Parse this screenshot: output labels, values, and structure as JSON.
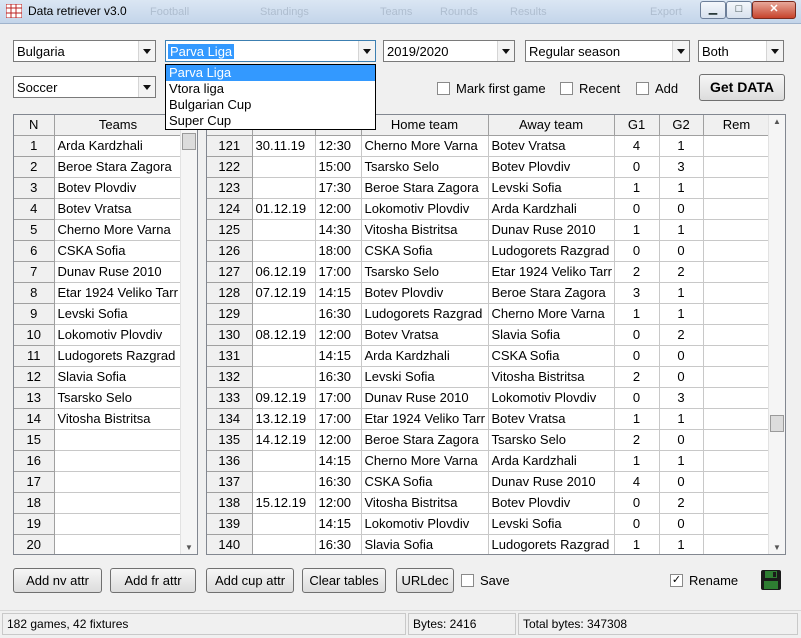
{
  "window": {
    "title": "Data retriever v3.0",
    "background_tabs": [
      "Football",
      "Standings",
      "Teams",
      "Rounds",
      "Results",
      "Export"
    ]
  },
  "filters": {
    "country": "Bulgaria",
    "league": "Parva Liga",
    "league_options": [
      "Parva Liga",
      "Vtora liga",
      "Bulgarian Cup",
      "Super Cup"
    ],
    "season": "2019/2020",
    "stage": "Regular season",
    "side": "Both",
    "sport": "Soccer"
  },
  "options": {
    "mark_first_game": "Mark first game",
    "recent": "Recent",
    "add": "Add",
    "get_data": "Get DATA"
  },
  "teams_grid": {
    "headers": [
      "N",
      "Teams"
    ],
    "rows": [
      [
        "1",
        "Arda Kardzhali"
      ],
      [
        "2",
        "Beroe Stara Zagora"
      ],
      [
        "3",
        "Botev Plovdiv"
      ],
      [
        "4",
        "Botev Vratsa"
      ],
      [
        "5",
        "Cherno More Varna"
      ],
      [
        "6",
        "CSKA Sofia"
      ],
      [
        "7",
        "Dunav Ruse 2010"
      ],
      [
        "8",
        "Etar 1924 Veliko Tarr"
      ],
      [
        "9",
        "Levski Sofia"
      ],
      [
        "10",
        "Lokomotiv Plovdiv"
      ],
      [
        "11",
        "Ludogorets Razgrad"
      ],
      [
        "12",
        "Slavia Sofia"
      ],
      [
        "13",
        "Tsarsko Selo"
      ],
      [
        "14",
        "Vitosha Bistritsa"
      ],
      [
        "15",
        ""
      ],
      [
        "16",
        ""
      ],
      [
        "17",
        ""
      ],
      [
        "18",
        ""
      ],
      [
        "19",
        ""
      ],
      [
        "20",
        ""
      ]
    ]
  },
  "games_grid": {
    "headers": [
      "",
      "",
      "",
      "Home team",
      "Away team",
      "G1",
      "G2",
      "Rem"
    ],
    "rows": [
      [
        "121",
        "30.11.19",
        "12:30",
        "Cherno More Varna",
        "Botev Vratsa",
        "4",
        "1",
        ""
      ],
      [
        "122",
        "",
        "15:00",
        "Tsarsko Selo",
        "Botev Plovdiv",
        "0",
        "3",
        ""
      ],
      [
        "123",
        "",
        "17:30",
        "Beroe Stara Zagora",
        "Levski Sofia",
        "1",
        "1",
        ""
      ],
      [
        "124",
        "01.12.19",
        "12:00",
        "Lokomotiv Plovdiv",
        "Arda Kardzhali",
        "0",
        "0",
        ""
      ],
      [
        "125",
        "",
        "14:30",
        "Vitosha Bistritsa",
        "Dunav Ruse 2010",
        "1",
        "1",
        ""
      ],
      [
        "126",
        "",
        "18:00",
        "CSKA Sofia",
        "Ludogorets Razgrad",
        "0",
        "0",
        ""
      ],
      [
        "127",
        "06.12.19",
        "17:00",
        "Tsarsko Selo",
        "Etar 1924 Veliko Tarr",
        "2",
        "2",
        ""
      ],
      [
        "128",
        "07.12.19",
        "14:15",
        "Botev Plovdiv",
        "Beroe Stara Zagora",
        "3",
        "1",
        ""
      ],
      [
        "129",
        "",
        "16:30",
        "Ludogorets Razgrad",
        "Cherno More Varna",
        "1",
        "1",
        ""
      ],
      [
        "130",
        "08.12.19",
        "12:00",
        "Botev Vratsa",
        "Slavia Sofia",
        "0",
        "2",
        ""
      ],
      [
        "131",
        "",
        "14:15",
        "Arda Kardzhali",
        "CSKA Sofia",
        "0",
        "0",
        ""
      ],
      [
        "132",
        "",
        "16:30",
        "Levski Sofia",
        "Vitosha Bistritsa",
        "2",
        "0",
        ""
      ],
      [
        "133",
        "09.12.19",
        "17:00",
        "Dunav Ruse 2010",
        "Lokomotiv Plovdiv",
        "0",
        "3",
        ""
      ],
      [
        "134",
        "13.12.19",
        "17:00",
        "Etar 1924 Veliko Tarr",
        "Botev Vratsa",
        "1",
        "1",
        ""
      ],
      [
        "135",
        "14.12.19",
        "12:00",
        "Beroe Stara Zagora",
        "Tsarsko Selo",
        "2",
        "0",
        ""
      ],
      [
        "136",
        "",
        "14:15",
        "Cherno More Varna",
        "Arda Kardzhali",
        "1",
        "1",
        ""
      ],
      [
        "137",
        "",
        "16:30",
        "CSKA Sofia",
        "Dunav Ruse 2010",
        "4",
        "0",
        ""
      ],
      [
        "138",
        "15.12.19",
        "12:00",
        "Vitosha Bistritsa",
        "Botev Plovdiv",
        "0",
        "2",
        ""
      ],
      [
        "139",
        "",
        "14:15",
        "Lokomotiv Plovdiv",
        "Levski Sofia",
        "0",
        "0",
        ""
      ],
      [
        "140",
        "",
        "16:30",
        "Slavia Sofia",
        "Ludogorets Razgrad",
        "1",
        "1",
        ""
      ]
    ]
  },
  "actions": {
    "add_nv_attr": "Add nv attr",
    "add_fr_attr": "Add fr attr",
    "add_cup_attr": "Add cup attr",
    "clear_tables": "Clear tables",
    "urldec": "URLdec",
    "save": "Save",
    "rename": "Rename"
  },
  "status": {
    "games": "182 games, 42 fixtures",
    "bytes": "Bytes: 2416",
    "total_bytes": "Total bytes: 347308"
  },
  "colors": {
    "selection": "#3399ff",
    "grid_fixed": "#f0f0f0",
    "save_icon": "#2e7d32"
  }
}
